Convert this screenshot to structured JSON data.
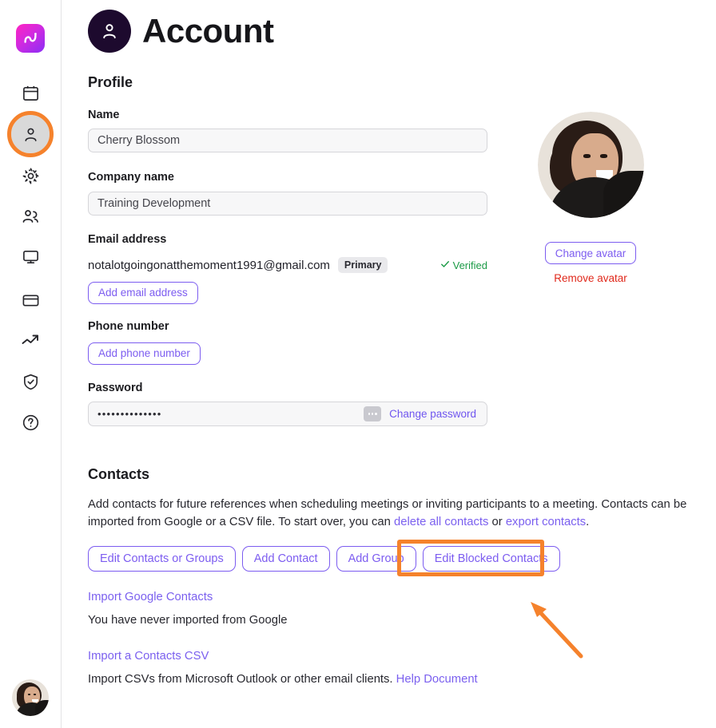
{
  "sidebar": {
    "logo_name": "app-logo",
    "items": [
      {
        "icon": "calendar-icon",
        "name": "sidebar-item-calendar",
        "selected": false
      },
      {
        "icon": "person-icon",
        "name": "sidebar-item-account",
        "selected": true
      },
      {
        "icon": "gear-icon",
        "name": "sidebar-item-settings",
        "selected": false
      },
      {
        "icon": "people-icon",
        "name": "sidebar-item-team",
        "selected": false
      },
      {
        "icon": "monitor-icon",
        "name": "sidebar-item-display",
        "selected": false
      },
      {
        "icon": "credit-card-icon",
        "name": "sidebar-item-billing",
        "selected": false
      },
      {
        "icon": "trending-up-icon",
        "name": "sidebar-item-analytics",
        "selected": false
      },
      {
        "icon": "shield-check-icon",
        "name": "sidebar-item-security",
        "selected": false
      },
      {
        "icon": "help-circle-icon",
        "name": "sidebar-item-help",
        "selected": false
      }
    ],
    "user_avatar_alt": "user avatar"
  },
  "header": {
    "title": "Account",
    "icon": "person-icon"
  },
  "profile": {
    "heading": "Profile",
    "name_label": "Name",
    "name_value": "Cherry Blossom",
    "company_label": "Company name",
    "company_value": "Training Development",
    "email_label": "Email address",
    "email_value": "notalotgoingonatthemoment1991@gmail.com",
    "email_badge": "Primary",
    "email_verified": "Verified",
    "add_email_label": "Add email address",
    "phone_label": "Phone number",
    "add_phone_label": "Add phone number",
    "password_label": "Password",
    "password_masked": "••••••••••••••",
    "change_password_label": "Change password"
  },
  "avatar_panel": {
    "change_label": "Change avatar",
    "remove_label": "Remove avatar"
  },
  "contacts": {
    "heading": "Contacts",
    "description_part1": "Add contacts for future references when scheduling meetings or inviting participants to a meeting. Contacts can be imported from Google or a CSV file. To start over, you can ",
    "link_delete_all": "delete all contacts",
    "description_or": " or ",
    "link_export": "export contacts",
    "description_end": ".",
    "buttons": [
      {
        "label": "Edit Contacts or Groups",
        "name": "edit-contacts-or-groups-button"
      },
      {
        "label": "Add Contact",
        "name": "add-contact-button"
      },
      {
        "label": "Add Group",
        "name": "add-group-button"
      },
      {
        "label": "Edit Blocked Contacts",
        "name": "edit-blocked-contacts-button"
      }
    ],
    "import_google_link": "Import Google Contacts",
    "import_google_note": "You have never imported from Google",
    "import_csv_link": "Import a Contacts CSV",
    "import_csv_note_part1": "Import CSVs from Microsoft Outlook or other email clients. ",
    "import_csv_help_link": "Help Document"
  },
  "annotation": {
    "highlight_color": "#f5822c",
    "highlight_target": "Edit Blocked Contacts",
    "arrow": "up-left-arrow"
  },
  "colors": {
    "accent_purple": "#7c5cf0",
    "highlight_orange": "#f5822c",
    "verified_green": "#1b9a46",
    "danger_red": "#e0281b",
    "header_circle": "#1d0a2e"
  }
}
